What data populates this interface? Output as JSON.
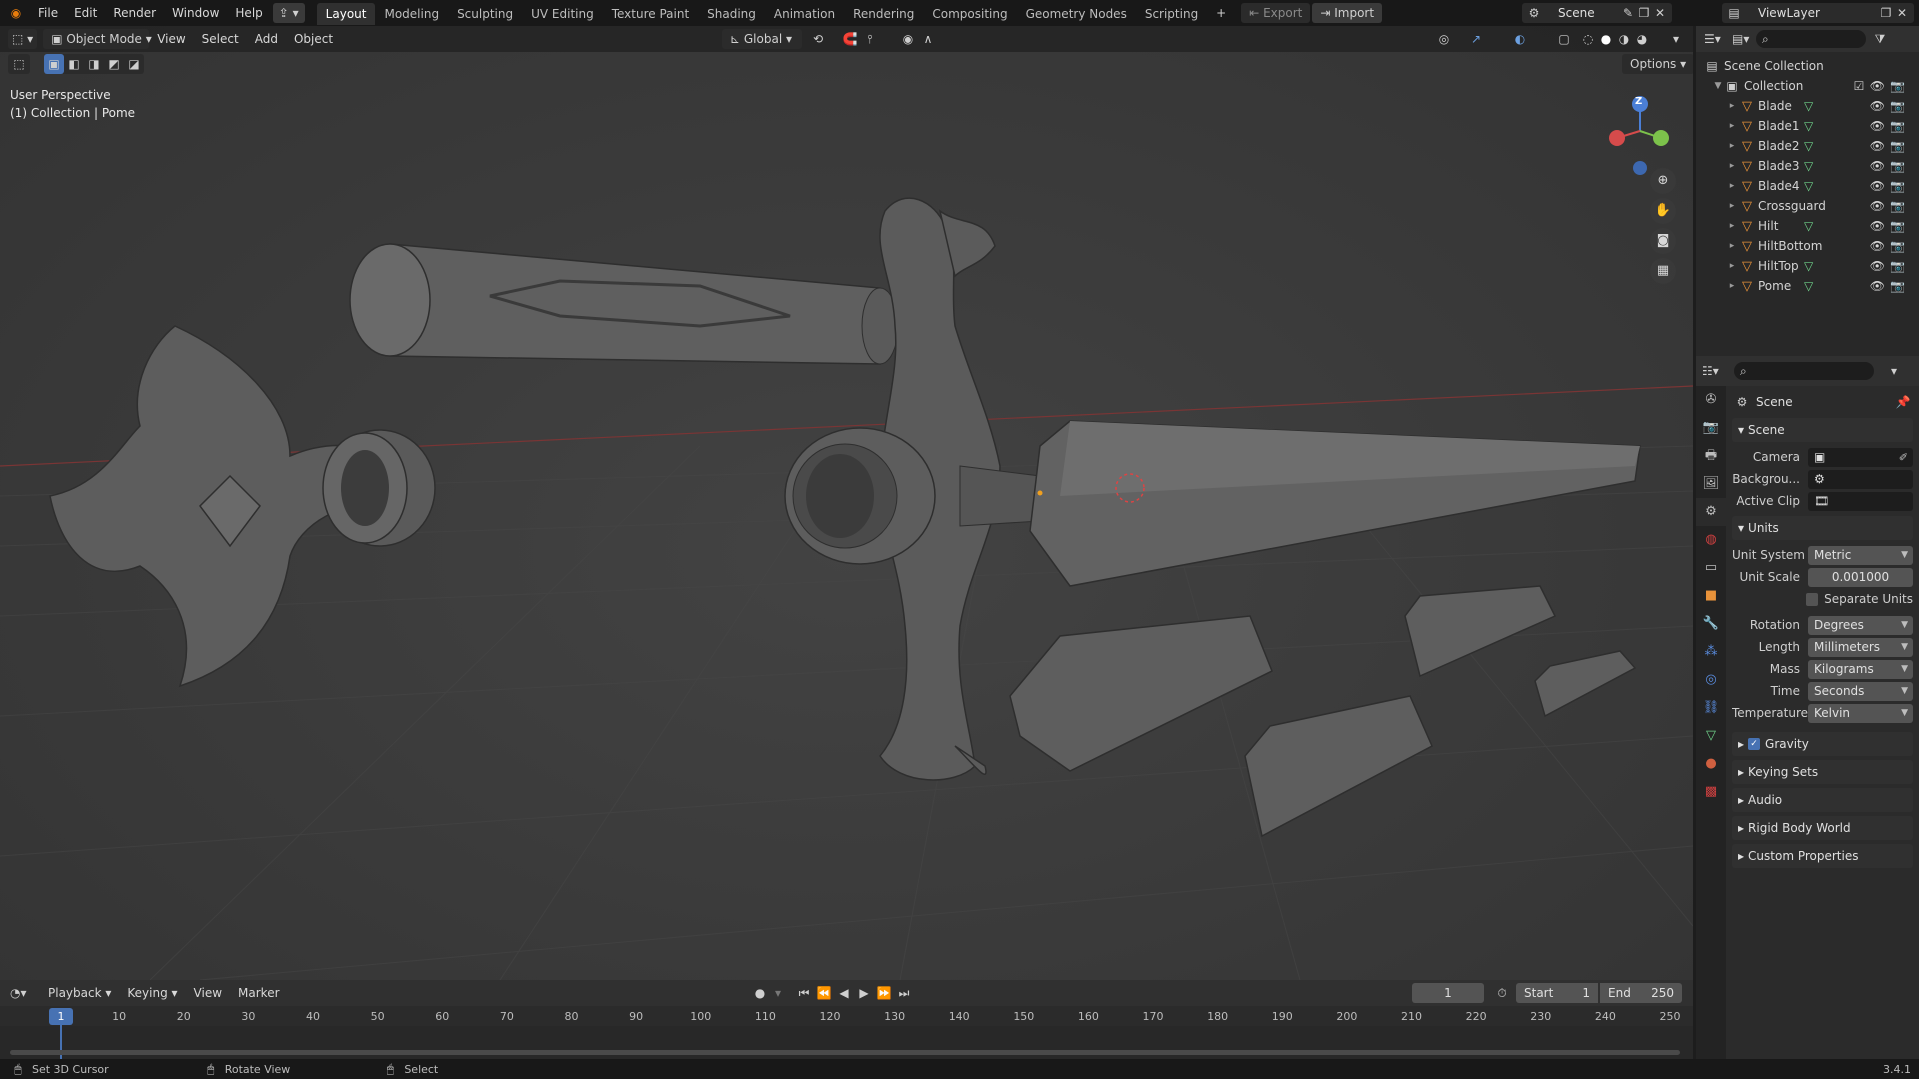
{
  "topbar": {
    "menus": [
      "File",
      "Edit",
      "Render",
      "Window",
      "Help"
    ],
    "workspaces": [
      "Layout",
      "Modeling",
      "Sculpting",
      "UV Editing",
      "Texture Paint",
      "Shading",
      "Animation",
      "Rendering",
      "Compositing",
      "Geometry Nodes",
      "Scripting"
    ],
    "active_workspace": "Layout",
    "export_label": "Export",
    "import_label": "Import",
    "scene_name": "Scene",
    "viewlayer_name": "ViewLayer"
  },
  "viewport": {
    "mode": "Object Mode",
    "menus": [
      "View",
      "Select",
      "Add",
      "Object"
    ],
    "transform_orientation": "Global",
    "options_label": "Options",
    "overlay_line1": "User Perspective",
    "overlay_line2": "(1) Collection | Pome",
    "axis_z": "Z"
  },
  "outliner": {
    "root": "Scene Collection",
    "collection": "Collection",
    "objects": [
      "Blade",
      "Blade1",
      "Blade2",
      "Blade3",
      "Blade4",
      "Crossguard",
      "Hilt",
      "HiltBottom",
      "HiltTop",
      "Pome"
    ]
  },
  "properties": {
    "context_title": "Scene",
    "scene_section": "Scene",
    "camera_label": "Camera",
    "background_label": "Backgrou...",
    "active_clip_label": "Active Clip",
    "units_section": "Units",
    "unit_system_label": "Unit System",
    "unit_system": "Metric",
    "unit_scale_label": "Unit Scale",
    "unit_scale": "0.001000",
    "separate_units": "Separate Units",
    "rotation_label": "Rotation",
    "rotation": "Degrees",
    "length_label": "Length",
    "length": "Millimeters",
    "mass_label": "Mass",
    "mass": "Kilograms",
    "time_label": "Time",
    "time": "Seconds",
    "temperature_label": "Temperature",
    "temperature": "Kelvin",
    "collapsed_sections": [
      "Gravity",
      "Keying Sets",
      "Audio",
      "Rigid Body World",
      "Custom Properties"
    ]
  },
  "timeline": {
    "menus": [
      "Playback",
      "Keying",
      "View",
      "Marker"
    ],
    "current_frame": "1",
    "start_label": "Start",
    "start": "1",
    "end_label": "End",
    "end": "250",
    "ticks": [
      "10",
      "20",
      "30",
      "40",
      "50",
      "60",
      "70",
      "80",
      "90",
      "100",
      "110",
      "120",
      "130",
      "140",
      "150",
      "160",
      "170",
      "180",
      "190",
      "200",
      "210",
      "220",
      "230",
      "240",
      "250"
    ]
  },
  "statusbar": {
    "hint1": "Set 3D Cursor",
    "hint2": "Rotate View",
    "hint3": "Select",
    "version": "3.4.1"
  },
  "colors": {
    "accent": "#4772b3",
    "object_orange": "#e8923a",
    "mesh_green": "#6fd18a"
  }
}
